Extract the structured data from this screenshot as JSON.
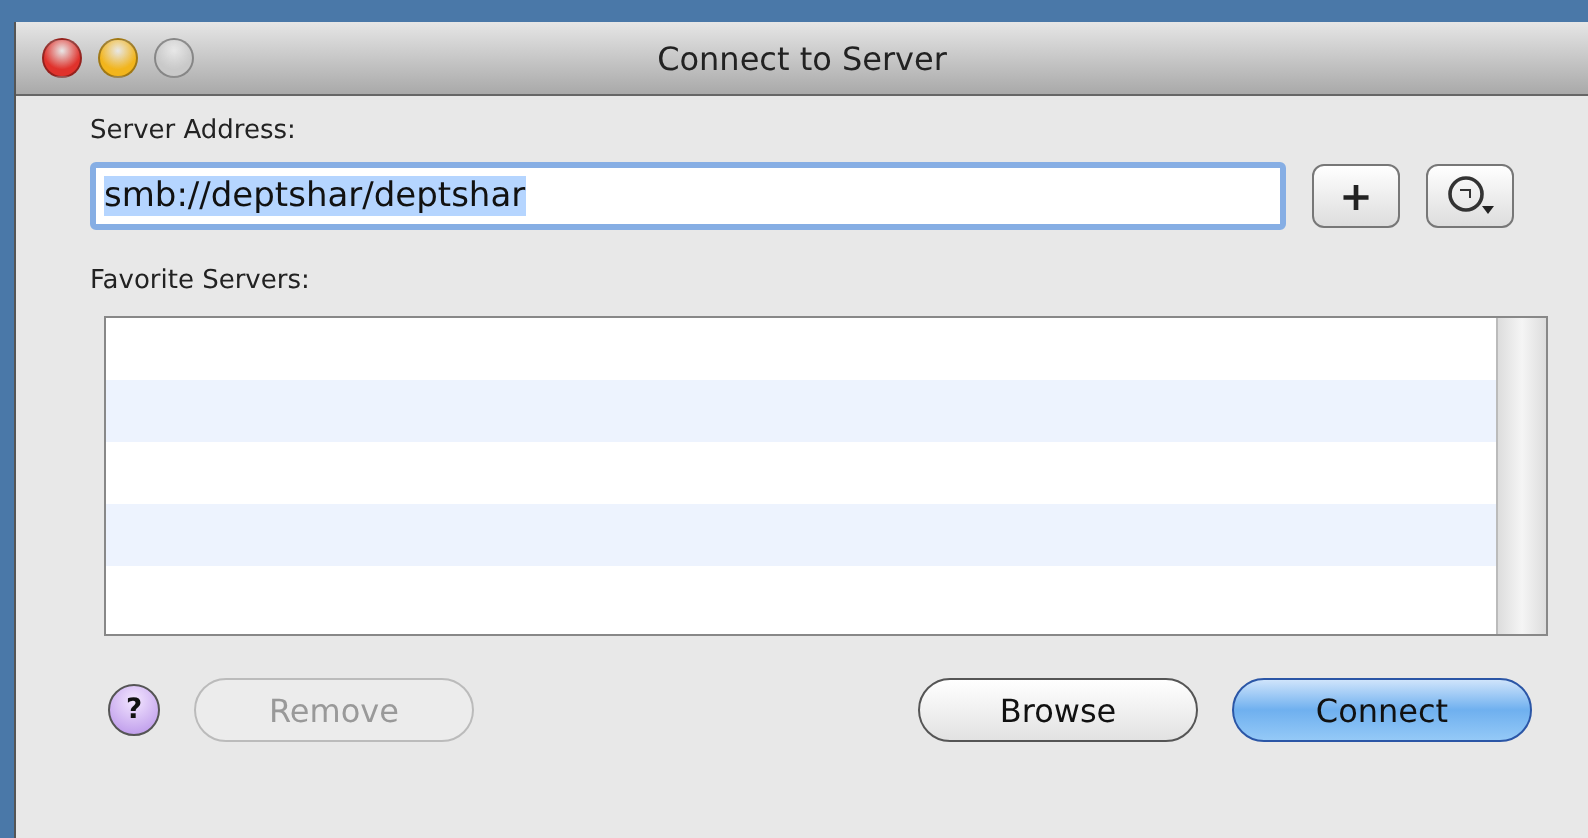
{
  "window": {
    "title": "Connect to Server"
  },
  "server_address": {
    "label": "Server Address:",
    "value": "smb://deptshar/deptshar",
    "add_button": "+"
  },
  "favorites": {
    "label": "Favorite Servers:"
  },
  "buttons": [
    {
      "label": "?",
      "kind": "help"
    },
    {
      "label": "Remove",
      "kind": "push",
      "disabled": true
    },
    {
      "label": "Browse",
      "kind": "push",
      "disabled": false
    },
    {
      "label": "Connect",
      "kind": "default",
      "disabled": false
    }
  ]
}
